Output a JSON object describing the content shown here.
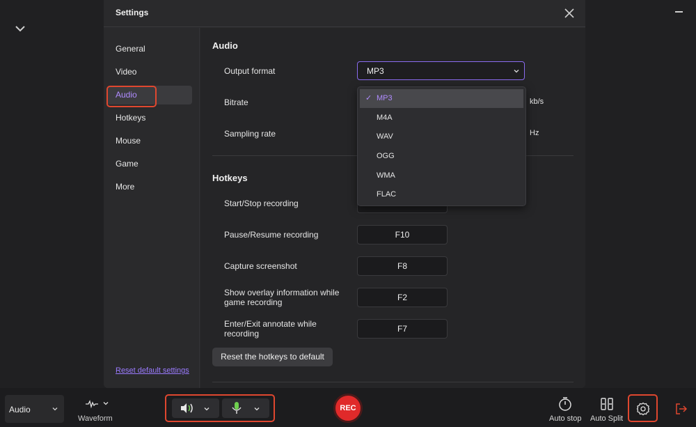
{
  "dialog": {
    "title": "Settings",
    "nav": [
      "General",
      "Video",
      "Audio",
      "Hotkeys",
      "Mouse",
      "Game",
      "More"
    ],
    "active_nav": "Audio",
    "reset_defaults": "Reset default settings"
  },
  "audio": {
    "title": "Audio",
    "output_format_label": "Output format",
    "output_format_value": "MP3",
    "bitrate_label": "Bitrate",
    "bitrate_unit": "kb/s",
    "sampling_label": "Sampling rate",
    "sampling_unit": "Hz",
    "format_options": [
      "MP3",
      "M4A",
      "WAV",
      "OGG",
      "WMA",
      "FLAC"
    ],
    "selected_option": "MP3"
  },
  "hotkeys": {
    "title": "Hotkeys",
    "rows": [
      {
        "label": "Start/Stop recording",
        "key": ""
      },
      {
        "label": "Pause/Resume recording",
        "key": "F10"
      },
      {
        "label": "Capture screenshot",
        "key": "F8"
      },
      {
        "label": "Show overlay information while game recording",
        "key": "F2"
      },
      {
        "label": "Enter/Exit annotate while recording",
        "key": "F7"
      }
    ],
    "reset_label": "Reset the hotkeys to default"
  },
  "bottombar": {
    "mode": "Audio",
    "waveform_label": "Waveform",
    "rec_label": "REC",
    "auto_stop_label": "Auto stop",
    "auto_split_label": "Auto Split"
  },
  "colors": {
    "accent": "#9b7bff",
    "highlight": "#e0472f",
    "rec": "#e02a2a"
  }
}
